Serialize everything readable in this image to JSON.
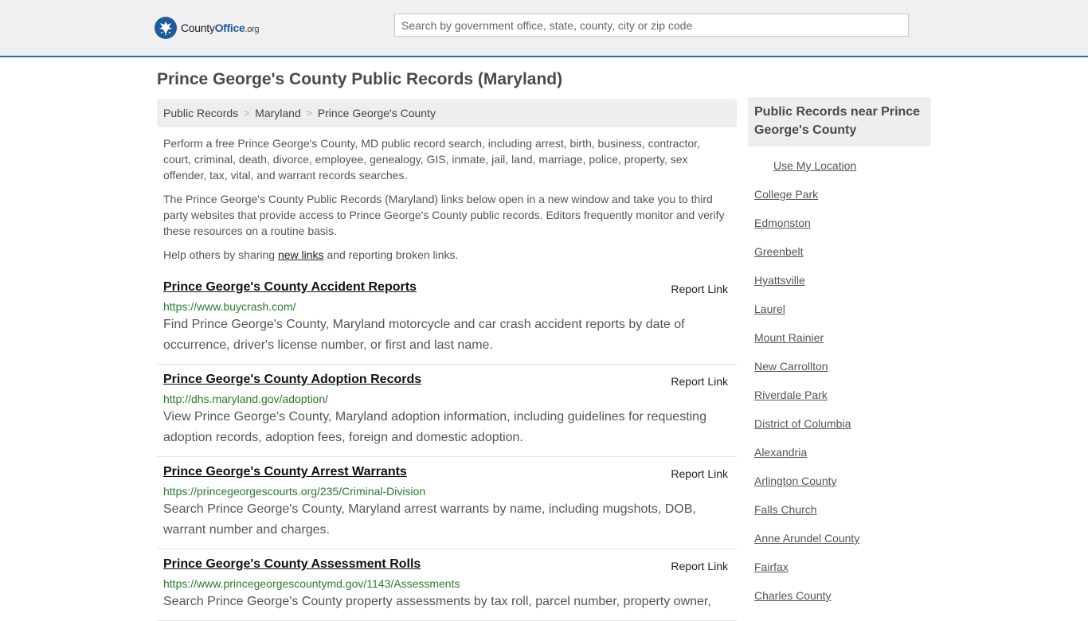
{
  "header": {
    "logo_county": "County",
    "logo_office": "Office",
    "logo_tld": ".org",
    "search_placeholder": "Search by government office, state, county, city or zip code"
  },
  "page_title": "Prince George's County Public Records (Maryland)",
  "breadcrumb": [
    {
      "label": "Public Records"
    },
    {
      "label": "Maryland"
    },
    {
      "label": "Prince George's County"
    }
  ],
  "intro": {
    "p1": "Perform a free Prince George's County, MD public record search, including arrest, birth, business, contractor, court, criminal, death, divorce, employee, genealogy, GIS, inmate, jail, land, marriage, police, property, sex offender, tax, vital, and warrant records searches.",
    "p2": "The Prince George's County Public Records (Maryland) links below open in a new window and take you to third party websites that provide access to Prince George's County public records. Editors frequently monitor and verify these resources on a routine basis.",
    "p3_before": "Help others by sharing ",
    "p3_link": "new links",
    "p3_after": " and reporting broken links."
  },
  "records": [
    {
      "title": "Prince George's County Accident Reports",
      "url": "https://www.buycrash.com/",
      "desc": "Find Prince George's County, Maryland motorcycle and car crash accident reports by date of occurrence, driver's license number, or first and last name.",
      "report_label": "Report Link"
    },
    {
      "title": "Prince George's County Adoption Records",
      "url": "http://dhs.maryland.gov/adoption/",
      "desc": "View Prince George's County, Maryland adoption information, including guidelines for requesting adoption records, adoption fees, foreign and domestic adoption.",
      "report_label": "Report Link"
    },
    {
      "title": "Prince George's County Arrest Warrants",
      "url": "https://princegeorgescourts.org/235/Criminal-Division",
      "desc": "Search Prince George's County, Maryland arrest warrants by name, including mugshots, DOB, warrant number and charges.",
      "report_label": "Report Link"
    },
    {
      "title": "Prince George's County Assessment Rolls",
      "url": "https://www.princegeorgescountymd.gov/1143/Assessments",
      "desc": "Search Prince George's County property assessments by tax roll, parcel number, property owner,",
      "report_label": "Report Link"
    }
  ],
  "sidebar": {
    "heading": "Public Records near Prince George's County",
    "use_location": "Use My Location",
    "links": [
      "College Park",
      "Edmonston",
      "Greenbelt",
      "Hyattsville",
      "Laurel",
      "Mount Rainier",
      "New Carrollton",
      "Riverdale Park",
      "District of Columbia",
      "Alexandria",
      "Arlington County",
      "Falls Church",
      "Anne Arundel County",
      "Fairfax",
      "Charles County"
    ]
  },
  "colors": {
    "brand_blue": "#1f5b9b",
    "url_green": "#2a7a2a",
    "header_border": "#2d6cb2"
  }
}
